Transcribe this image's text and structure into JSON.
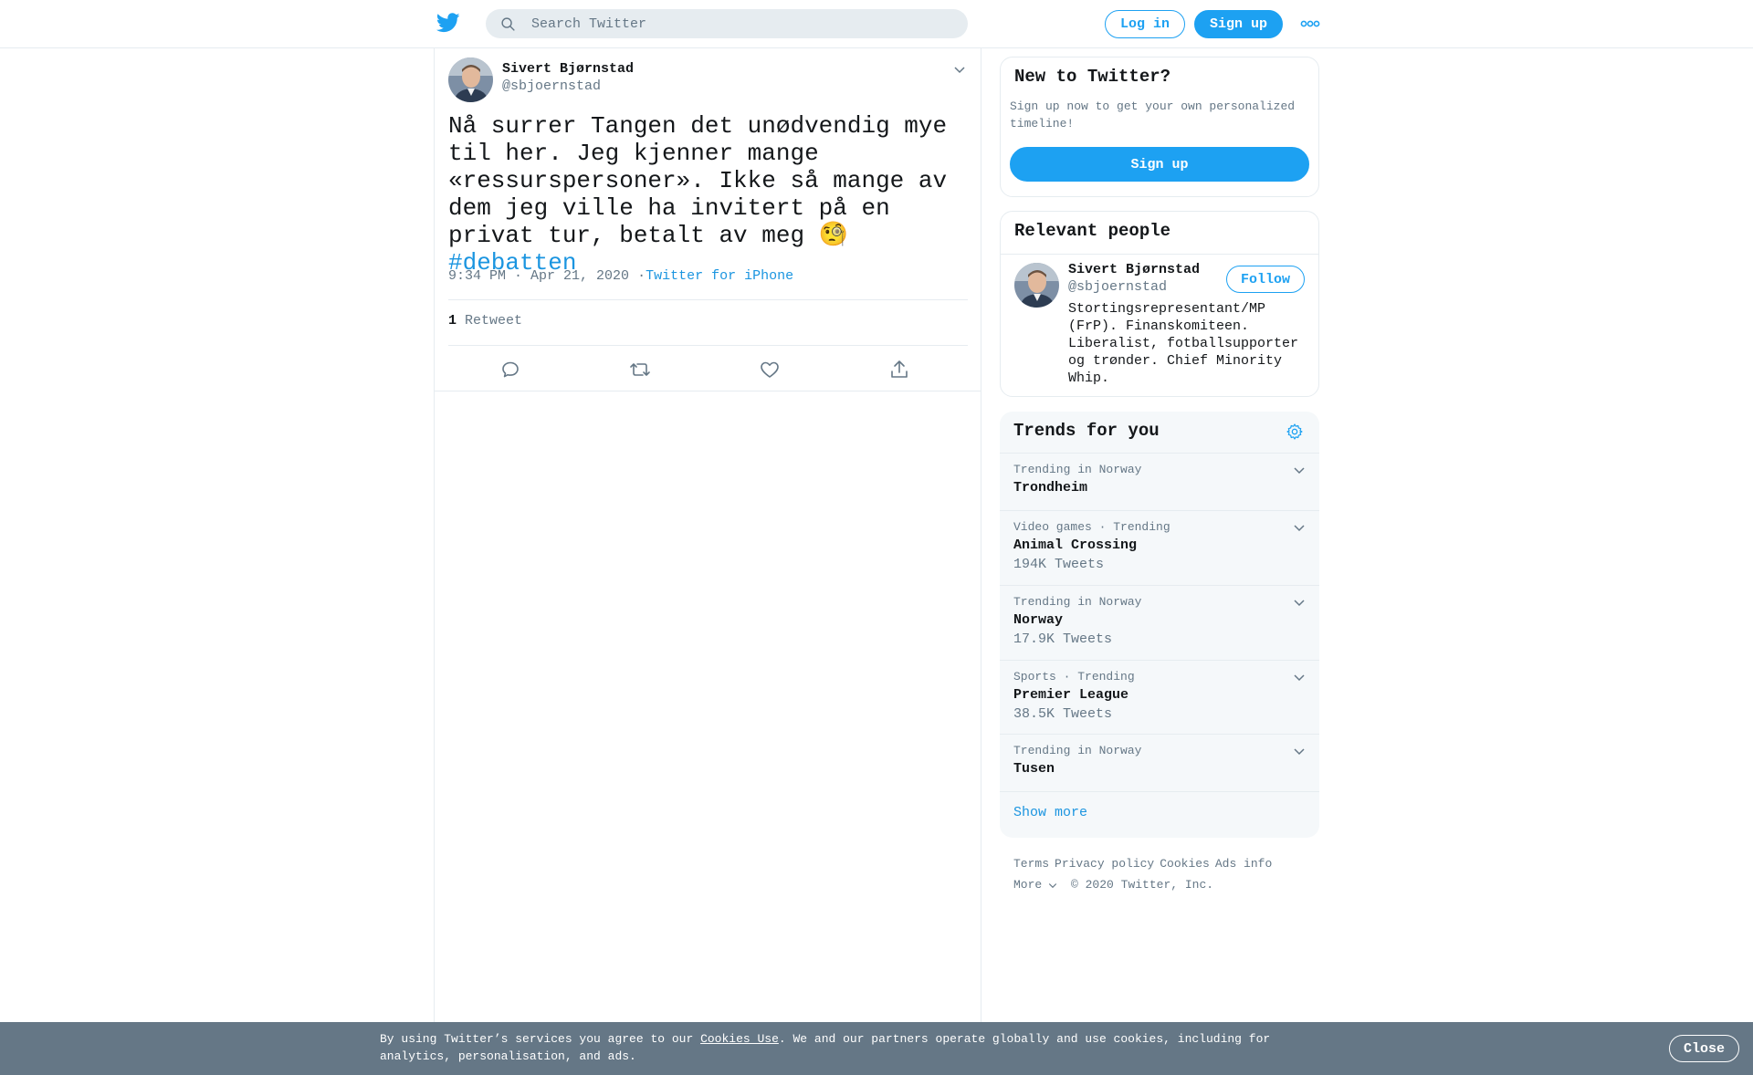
{
  "header": {
    "logo_icon": "twitter-bird-icon",
    "search_placeholder": "Search Twitter",
    "login_label": "Log in",
    "signup_label": "Sign up",
    "more_icon": "more-dots-icon"
  },
  "tweet": {
    "author_name": "Sivert Bjørnstad",
    "author_handle": "@sbjoernstad",
    "text": "Nå surrer Tangen det unødvendig mye til her. Jeg kjenner mange «ressurspersoner». Ikke så mange av dem jeg ville ha invitert på en privat tur, betalt av meg ",
    "emoji": "🧐",
    "hashtag": "#debatten",
    "time": "9:34 PM · Apr 21, 2020",
    "separator": "·",
    "source": "Twitter for iPhone",
    "retweet_count": "1",
    "retweet_label": "Retweet",
    "actions": [
      "reply-icon",
      "retweet-icon",
      "like-icon",
      "share-icon"
    ]
  },
  "sidebar": {
    "new_card": {
      "title": "New to Twitter?",
      "description": "Sign up now to get your own personalized timeline!",
      "signup_label": "Sign up"
    },
    "people_card": {
      "title": "Relevant people",
      "name": "Sivert Bjørnstad",
      "handle": "@sbjoernstad",
      "follow_label": "Follow",
      "bio": "Stortingsrepresentant/MP (FrP). Finanskomiteen. Liberalist, fotballsupporter og trønder. Chief Minority Whip."
    },
    "trends_card": {
      "title": "Trends for you",
      "trends": [
        {
          "context": "Trending in Norway",
          "name": "Trondheim",
          "count": ""
        },
        {
          "context": "Video games · Trending",
          "name": "Animal Crossing",
          "count": "194K Tweets"
        },
        {
          "context": "Trending in Norway",
          "name": "Norway",
          "count": "17.9K Tweets"
        },
        {
          "context": "Sports · Trending",
          "name": "Premier League",
          "count": "38.5K Tweets"
        },
        {
          "context": "Trending in Norway",
          "name": "Tusen",
          "count": ""
        }
      ],
      "show_more": "Show more"
    },
    "footer": {
      "links": [
        "Terms",
        "Privacy policy",
        "Cookies",
        "Ads info"
      ],
      "more": "More",
      "copyright": "© 2020 Twitter, Inc."
    }
  },
  "cookie_banner": {
    "text_before": "By using Twitter’s services you agree to our ",
    "link": "Cookies Use",
    "text_after": ". We and our partners operate globally and use cookies, including for analytics, personalisation, and ads.",
    "close_label": "Close"
  },
  "colors": {
    "accent": "#1da1f2",
    "link": "#1b95e0",
    "text": "#14171a",
    "secondary": "#657786",
    "banner": "#657786"
  }
}
